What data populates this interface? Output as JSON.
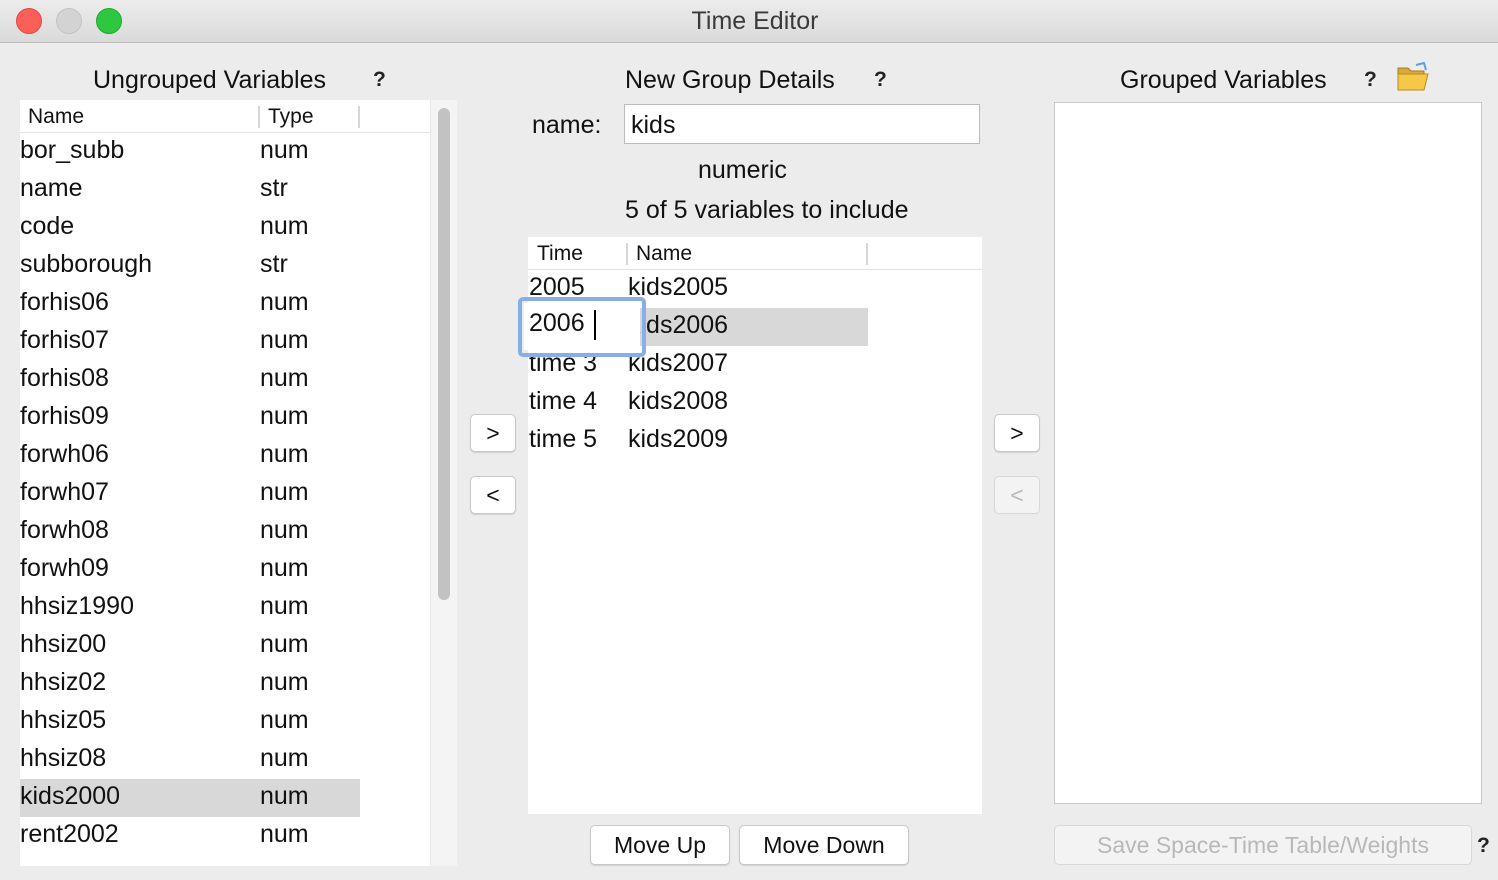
{
  "window": {
    "title": "Time Editor"
  },
  "ungrouped": {
    "heading": "Ungrouped Variables",
    "help": "?",
    "columns": [
      "Name",
      "Type"
    ],
    "rows": [
      [
        "bor_subb",
        "num"
      ],
      [
        "name",
        "str"
      ],
      [
        "code",
        "num"
      ],
      [
        "subborough",
        "str"
      ],
      [
        "forhis06",
        "num"
      ],
      [
        "forhis07",
        "num"
      ],
      [
        "forhis08",
        "num"
      ],
      [
        "forhis09",
        "num"
      ],
      [
        "forwh06",
        "num"
      ],
      [
        "forwh07",
        "num"
      ],
      [
        "forwh08",
        "num"
      ],
      [
        "forwh09",
        "num"
      ],
      [
        "hhsiz1990",
        "num"
      ],
      [
        "hhsiz00",
        "num"
      ],
      [
        "hhsiz02",
        "num"
      ],
      [
        "hhsiz05",
        "num"
      ],
      [
        "hhsiz08",
        "num"
      ],
      [
        "kids2000",
        "num"
      ],
      [
        "rent2002",
        "num"
      ]
    ],
    "selected_row": "kids2000"
  },
  "group_details": {
    "heading": "New Group Details",
    "help": "?",
    "name_label": "name:",
    "name_value": "kids",
    "type_text": "numeric",
    "count_text": "5 of 5 variables to include",
    "columns": [
      "Time",
      "Name"
    ],
    "rows": [
      [
        "2005",
        "kids2005"
      ],
      [
        "2006",
        "kids2006"
      ],
      [
        "time 3",
        "kids2007"
      ],
      [
        "time 4",
        "kids2008"
      ],
      [
        "time 5",
        "kids2009"
      ]
    ],
    "editing_value": "2006",
    "move_up_label": "Move Up",
    "move_down_label": "Move Down"
  },
  "transfer": {
    "add_label": ">",
    "remove_label": "<",
    "add_group_label": ">",
    "remove_group_label": "<"
  },
  "grouped": {
    "heading": "Grouped Variables",
    "help": "?",
    "open_icon": "folder-open-icon",
    "save_label": "Save Space-Time Table/Weights",
    "save_help": "?"
  }
}
